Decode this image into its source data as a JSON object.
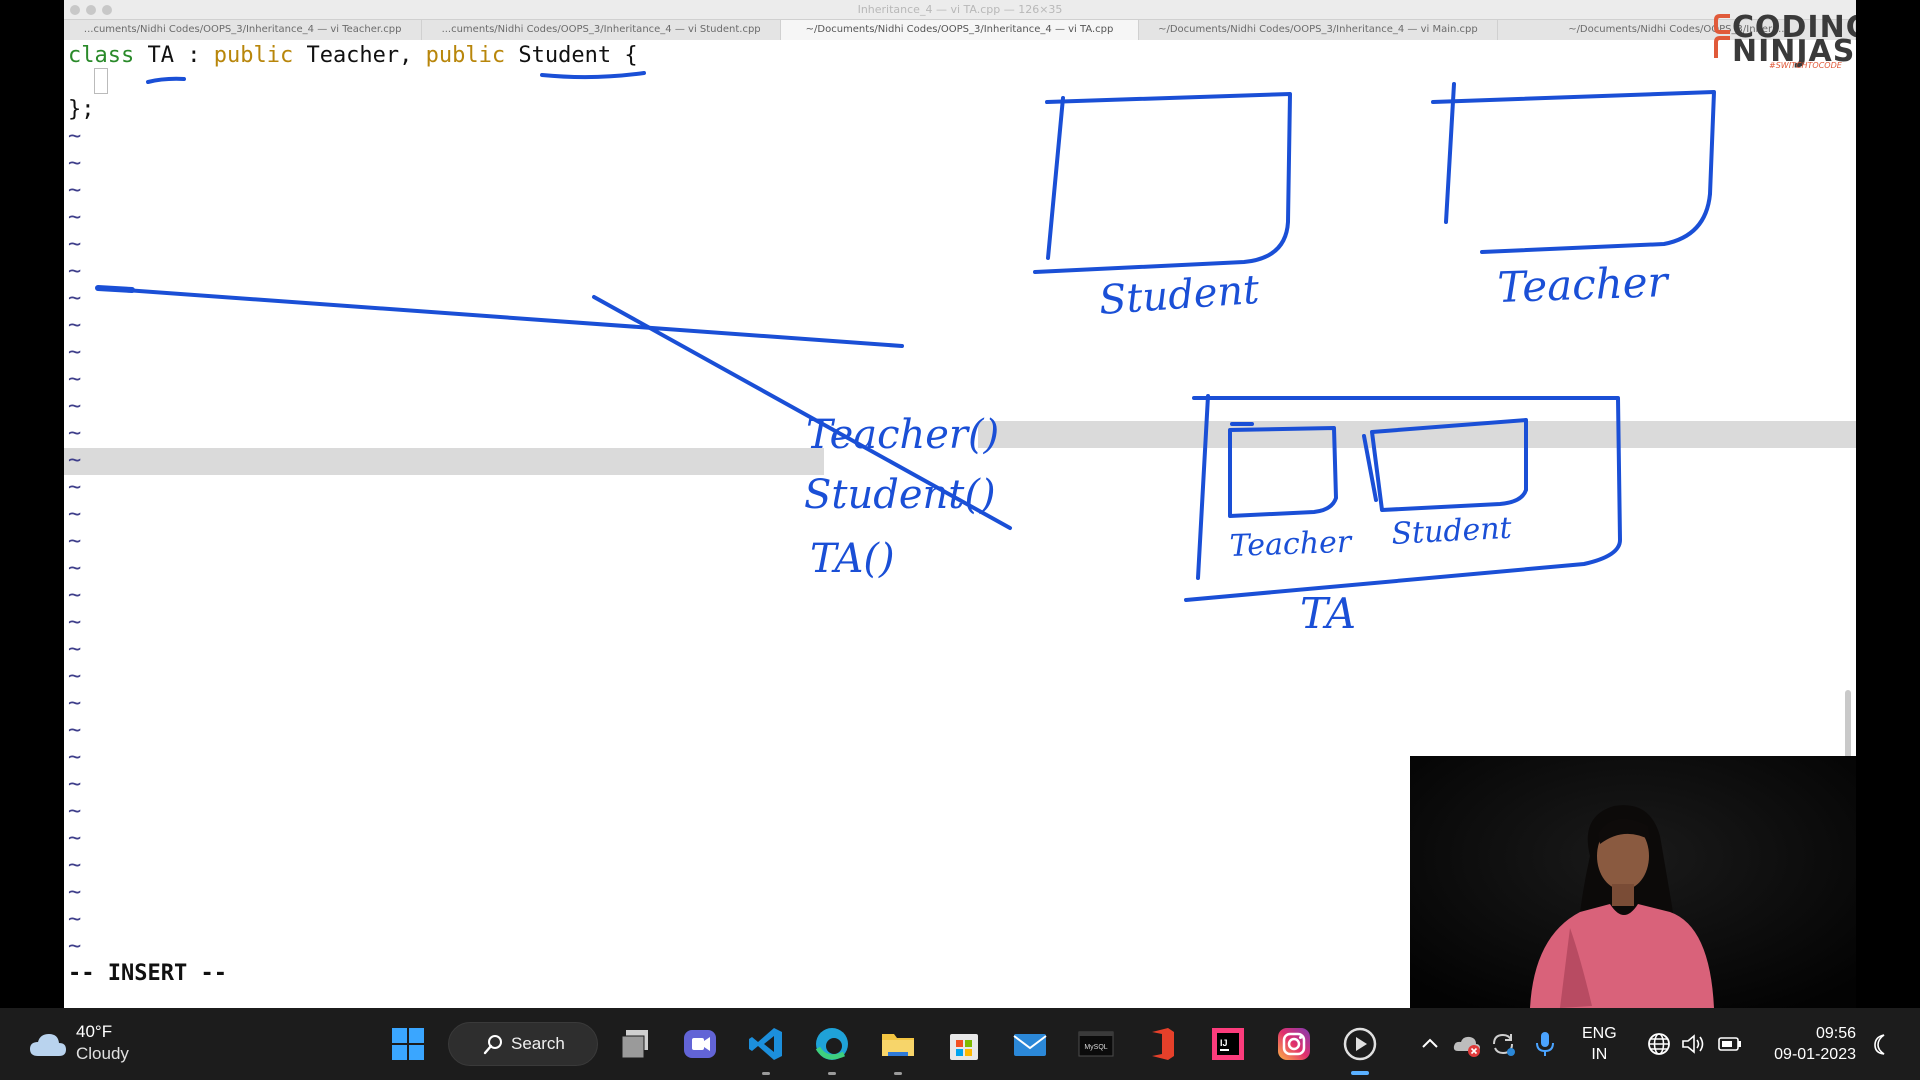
{
  "window": {
    "title": "Inheritance_4 — vi TA.cpp — 126×35"
  },
  "tabs": [
    {
      "label": "...cuments/Nidhi Codes/OOPS_3/Inheritance_4 — vi Teacher.cpp",
      "active": false
    },
    {
      "label": "...cuments/Nidhi Codes/OOPS_3/Inheritance_4 — vi Student.cpp",
      "active": false
    },
    {
      "label": "~/Documents/Nidhi Codes/OOPS_3/Inheritance_4 — vi TA.cpp",
      "active": true
    },
    {
      "label": "~/Documents/Nidhi Codes/OOPS_3/Inheritance_4 — vi Main.cpp",
      "active": false
    },
    {
      "label": "~/Documents/Nidhi Codes/OOPS_3/Inheri...",
      "active": false
    }
  ],
  "logo": {
    "line1": "CODING",
    "line2": "NINJAS",
    "tagline": "#SWITCHTOCODE"
  },
  "editor": {
    "line1": {
      "kw_class": "class",
      "name": " TA : ",
      "kw_public1": "public",
      "base1": " Teacher, ",
      "kw_public2": "public",
      "base2": " Student {"
    },
    "line2": "",
    "line3": "};",
    "tilde": "~",
    "tilde_count": 31,
    "mode": "-- INSERT --"
  },
  "annotations": {
    "box_student_label": "Student",
    "box_teacher_label": "Teacher",
    "call_teacher": "Teacher()",
    "call_student": "Student()",
    "call_ta": "TA()",
    "inner_teacher_label": "Teacher",
    "inner_student_label": "Student",
    "outer_ta_label": "TA",
    "ink_color": "#1a4fd6"
  },
  "taskbar": {
    "weather_temp": "40°F",
    "weather_condition": "Cloudy",
    "search_label": "Search",
    "lang_line1": "ENG",
    "lang_line2": "IN",
    "time": "09:56",
    "date": "09-01-2023",
    "apps": [
      "start-icon",
      "search-icon",
      "task-view-icon",
      "teams-icon",
      "vscode-icon",
      "edge-icon",
      "file-explorer-icon",
      "store-icon",
      "mail-icon",
      "mysql-icon",
      "office-icon",
      "intellij-icon",
      "instagram-icon",
      "media-player-icon"
    ]
  }
}
